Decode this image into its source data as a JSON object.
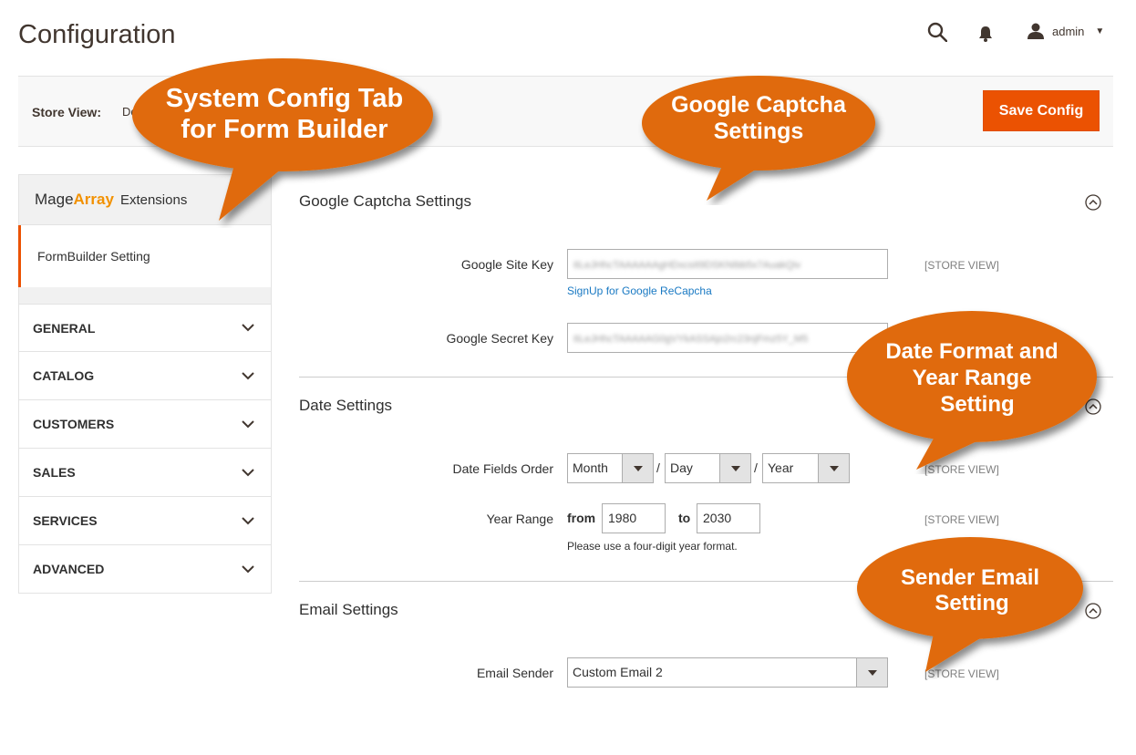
{
  "header": {
    "page_title": "Configuration",
    "user_name": "admin",
    "icons": [
      "search-icon",
      "bell-icon",
      "user-icon",
      "caret-down-icon"
    ]
  },
  "store_bar": {
    "label": "Store View:",
    "value": "De",
    "save_label": "Save Config"
  },
  "sidebar": {
    "brand_part1": "Mage",
    "brand_part2": "Array",
    "brand_part3": "Extensions",
    "active_item": "FormBuilder Setting",
    "sections": [
      "GENERAL",
      "CATALOG",
      "CUSTOMERS",
      "SALES",
      "SERVICES",
      "ADVANCED"
    ]
  },
  "google_captcha": {
    "title": "Google Captcha Settings",
    "site_key_label": "Google Site Key",
    "site_key_value": "6LeJHhcTAAAAAAgHDxcsIt9DSKNIbb5x7AuakQiv",
    "signup_link": "SignUp for Google ReCapcha",
    "secret_key_label": "Google Secret Key",
    "secret_key_value": "6LeJHhcTAAAAAG0gVYkASSAjo2rc23njFmz5Y_M5",
    "scope": "[STORE VIEW]"
  },
  "date_settings": {
    "title": "Date Settings",
    "order_label": "Date Fields Order",
    "order_month": "Month",
    "order_day": "Day",
    "order_year": "Year",
    "separator": "/",
    "range_label": "Year Range",
    "from_label": "from",
    "from_value": "1980",
    "to_label": "to",
    "to_value": "2030",
    "range_note": "Please use a four-digit year format.",
    "scope": "[STORE VIEW]"
  },
  "email_settings": {
    "title": "Email Settings",
    "sender_label": "Email Sender",
    "sender_value": "Custom Email 2",
    "scope": "[STORE VIEW]"
  },
  "callouts": {
    "system_config": [
      "System Config Tab",
      "for Form Builder"
    ],
    "captcha": [
      "Google Captcha",
      "Settings"
    ],
    "date_format": [
      "Date Format and",
      "Year Range",
      "Setting"
    ],
    "sender": [
      "Sender Email",
      "Setting"
    ]
  },
  "colors": {
    "accent": "#eb5202",
    "callout": "#e06b08",
    "link": "#1979c3"
  }
}
